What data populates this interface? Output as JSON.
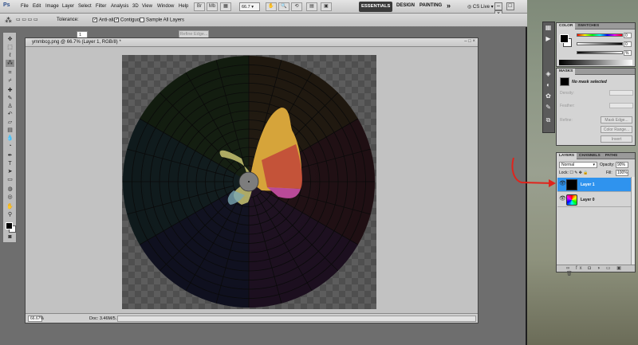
{
  "app": {
    "logo": "Ps",
    "menu": [
      "File",
      "Edit",
      "Image",
      "Layer",
      "Select",
      "Filter",
      "Analysis",
      "3D",
      "View",
      "Window",
      "Help"
    ],
    "zoom_select": "66.7",
    "workspaces": [
      "ESSENTIALS",
      "DESIGN",
      "PAINTING"
    ],
    "more_workspaces": "»",
    "cs_live": "CS Live",
    "window_buttons": [
      "–",
      "□",
      "×"
    ]
  },
  "options": {
    "tolerance_label": "Tolerance:",
    "tolerance_value": "1",
    "anti_alias": "Anti-alias",
    "contiguous": "Contiguous",
    "sample_all_layers": "Sample All Layers",
    "refine_edge": "Refine Edge..."
  },
  "tools": {
    "icons": [
      "move-icon",
      "marquee-icon",
      "lasso-icon",
      "magic-wand-icon",
      "crop-icon",
      "eyedropper-icon",
      "healing-icon",
      "brush-icon",
      "stamp-icon",
      "history-brush-icon",
      "eraser-icon",
      "gradient-icon",
      "blur-icon",
      "dodge-icon",
      "pen-icon",
      "type-icon",
      "path-select-icon",
      "shape-icon",
      "3d-rotate-icon",
      "3d-orbit-icon",
      "hand-icon",
      "zoom-icon"
    ],
    "foreground": "#000000",
    "background": "#ffffff"
  },
  "document": {
    "title": "ymmbcg.png @ 66.7% (Layer 1, RGB/8) *",
    "zoom": "66.67%",
    "doc_size": "Doc: 3.46M/5.11M"
  },
  "panels": {
    "color": {
      "tabs": [
        "COLOR",
        "SWATCHES"
      ],
      "sliders": [
        {
          "label": "",
          "value": "0"
        },
        {
          "label": "",
          "value": "0"
        },
        {
          "label": "",
          "value": "%"
        }
      ]
    },
    "masks": {
      "tab": "MASKS",
      "status": "No mask selected",
      "density_label": "Density:",
      "feather_label": "Feather:",
      "refine_label": "Refine:",
      "mask_edge": "Mask Edge...",
      "color_range": "Color Range...",
      "invert": "Invert"
    },
    "layers": {
      "tabs": [
        "LAYERS",
        "CHANNELS",
        "PATHS"
      ],
      "blend_mode": "Normal",
      "opacity_label": "Opacity:",
      "opacity_value": "90%",
      "lock_label": "Lock:",
      "fill_label": "Fill:",
      "fill_value": "100%",
      "items": [
        {
          "name": "Layer 1",
          "selected": true
        },
        {
          "name": "Layer 0",
          "selected": false
        }
      ],
      "footer": "∞ fx ◘ ◑ ▭ ▣ 🗑"
    }
  },
  "colors": {
    "accent_selected": "#2f93ee",
    "annotation_arrow": "#e0241c"
  }
}
